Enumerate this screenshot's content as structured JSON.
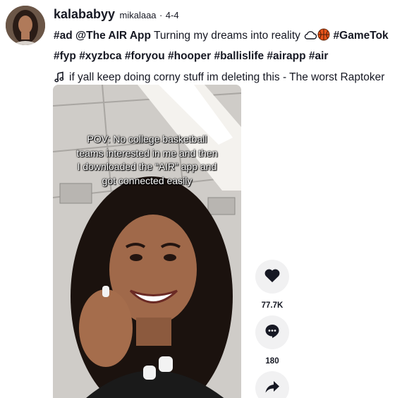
{
  "post": {
    "username": "kalababyy",
    "nickname": "mikalaaa",
    "separator": "·",
    "date": "4-4",
    "caption": {
      "ad_tag": "#ad",
      "mention": "@The AIR App",
      "text": "Turning my dreams into reality",
      "hashtags_line1": "#GameTok",
      "hashtags_line2": [
        "#fyp",
        "#xyzbca",
        "#foryou",
        "#hooper",
        "#ballislife",
        "#airapp",
        "#air"
      ]
    },
    "music": "if yall keep doing corny stuff im deleting this - The worst Raptoker",
    "video_overlay_text": "POV: No college basketball teams interested in me and then I downloaded the “AIR” app and got connected easily"
  },
  "actions": {
    "like_count": "77.7K",
    "comment_count": "180"
  },
  "icons": {
    "cloud": "cloud-icon",
    "basketball": "basketball-icon",
    "music": "music-note-icon",
    "like": "heart-icon",
    "comment": "comment-icon",
    "share": "share-icon"
  },
  "colors": {
    "text": "#161823",
    "action_bg": "#f1f1f2",
    "basketball": "#e8541a"
  }
}
